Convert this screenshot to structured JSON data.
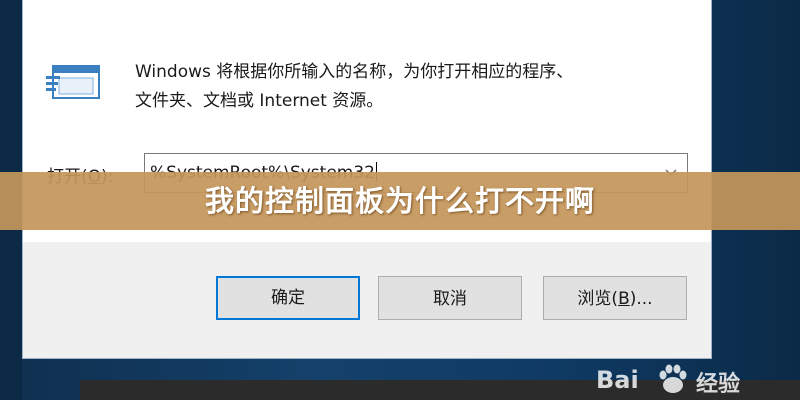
{
  "dialog": {
    "description_line1": "Windows 将根据你所输入的名称，为你打开相应的程序、",
    "description_line2": "文件夹、文档或 Internet 资源。",
    "open_label": "打开",
    "open_accel": "O",
    "open_value": "%SystemRoot%\\System32",
    "buttons": {
      "ok": "确定",
      "cancel": "取消",
      "browse": "浏览",
      "browse_accel": "B"
    }
  },
  "banner": {
    "text": "我的控制面板为什么打不开啊"
  },
  "watermark": {
    "brand": "Bai",
    "suffix": "经验"
  },
  "icons": {
    "run_icon": "run-dialog-icon",
    "combo_arrow": "chevron-down-icon",
    "watermark_paw": "baidu-paw-icon"
  },
  "colors": {
    "accent": "#0078d7",
    "banner": "#c4965a",
    "desktop": "#14416b"
  }
}
